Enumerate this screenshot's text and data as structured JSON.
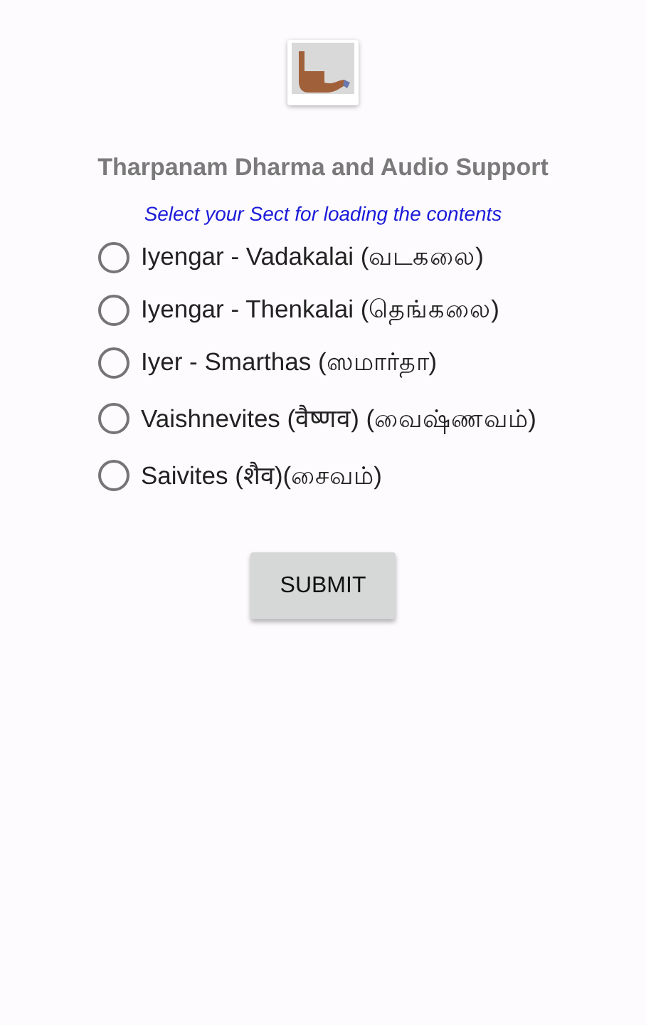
{
  "title": "Tharpanam Dharma and Audio Support",
  "subtitle": "Select your Sect for loading the contents",
  "options": [
    {
      "label": "Iyengar - Vadakalai (வடகலை)",
      "selected": false
    },
    {
      "label": "Iyengar - Thenkalai (தெங்கலை)",
      "selected": false
    },
    {
      "label": "Iyer - Smarthas (ஸமார்தா)",
      "selected": false
    },
    {
      "label": "Vaishnevites (वैष्णव) (வைஷ்ணவம்)",
      "selected": false
    },
    {
      "label": "Saivites (शैव)(சைவம்)",
      "selected": false
    }
  ],
  "submit_button": "SUBMIT"
}
